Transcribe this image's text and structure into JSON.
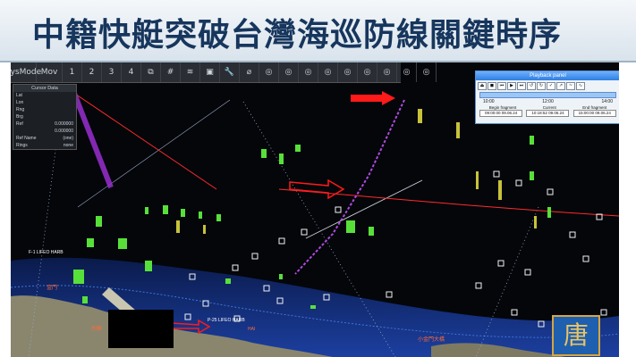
{
  "banner": {
    "title": "中籍快艇突破台灣海巡防線關鍵時序"
  },
  "toolbar": {
    "items": [
      {
        "name": "sysmode-button",
        "label": "SysMode"
      },
      {
        "name": "mov-button",
        "label": "Mov"
      },
      {
        "name": "layer-1-button",
        "label": "1"
      },
      {
        "name": "layer-2-button",
        "label": "2"
      },
      {
        "name": "layer-3-button",
        "label": "3"
      },
      {
        "name": "layer-4-button",
        "label": "4"
      },
      {
        "name": "window-button",
        "label": "⧉"
      },
      {
        "name": "grid-button",
        "label": "#"
      },
      {
        "name": "signal-button",
        "label": "≋"
      },
      {
        "name": "screen-button",
        "label": "▣"
      },
      {
        "name": "wrench-button",
        "label": "🔧"
      },
      {
        "name": "measure-button",
        "label": "⌀"
      },
      {
        "name": "radar-1-button",
        "label": "◎"
      },
      {
        "name": "radar-2-button",
        "label": "◎"
      },
      {
        "name": "radar-3-button",
        "label": "◎"
      },
      {
        "name": "radar-4-button",
        "label": "◎"
      },
      {
        "name": "radar-5-button",
        "label": "◎"
      },
      {
        "name": "radar-6-button",
        "label": "◎"
      },
      {
        "name": "radar-7-button",
        "label": "◎"
      },
      {
        "name": "radar-8-button",
        "label": "◎"
      },
      {
        "name": "radar-9-button",
        "label": "◎"
      }
    ]
  },
  "cursor_panel": {
    "title": "Cursor Data",
    "rows": [
      {
        "label": "Lat",
        "value": ""
      },
      {
        "label": "Lon",
        "value": ""
      },
      {
        "label": "Rng",
        "value": ""
      },
      {
        "label": "Brg",
        "value": ""
      },
      {
        "label": "Ref",
        "value": "0.000000"
      },
      {
        "label": "",
        "value": "0.000000"
      },
      {
        "label": "Ref Name",
        "value": "(one)"
      },
      {
        "label": "Rings",
        "value": "none"
      }
    ]
  },
  "playback": {
    "title": "Playback panel",
    "icons": [
      "⏏",
      "◼",
      "⏮",
      "▶",
      "⏭",
      "↺",
      "↻",
      "✓",
      "↗",
      "~",
      "∿"
    ],
    "times": [
      "10:00",
      "12:00",
      "14:00"
    ],
    "columns": [
      "Begin fragment",
      "Current",
      "End fragment"
    ],
    "fields": [
      "09:00:00 09.06.24",
      "10:18:52 09.06.24",
      "15:00:00 09.06.24"
    ]
  },
  "map_labels": [
    {
      "text": "F-1 LIFEO HARB",
      "color": "#ffffff"
    },
    {
      "text": "P-25 LIFEO HARB",
      "color": "#ffffff"
    },
    {
      "text": "金門",
      "color": "#ff6a3a"
    },
    {
      "text": "烈嶼",
      "color": "#ff6a3a"
    },
    {
      "text": "小金門大橋",
      "color": "#ff6a3a"
    },
    {
      "text": "HAI",
      "color": "#ff6a3a"
    }
  ],
  "colors": {
    "banner_text": "#17365d",
    "radar_bg": "#04060a",
    "track_green": "#58e03a",
    "track_purple": "#9a2fd0",
    "boundary_red": "#ff2b2b",
    "arrow_red": "#ff1a1a",
    "land": "#8a866e"
  },
  "logo": {
    "glyph": "唐"
  }
}
